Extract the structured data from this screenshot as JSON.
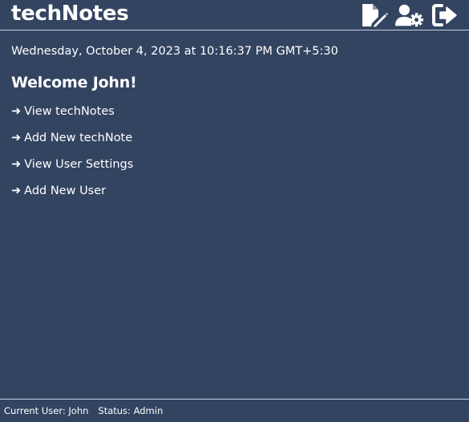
{
  "header": {
    "title": "techNotes",
    "actions": [
      {
        "name": "new-note-button",
        "icon": "file-pen-icon"
      },
      {
        "name": "user-settings-button",
        "icon": "user-gear-icon"
      },
      {
        "name": "logout-button",
        "icon": "sign-out-icon"
      }
    ]
  },
  "main": {
    "date": "Wednesday, October 4, 2023 at 10:16:37 PM GMT+5:30",
    "welcome": "Welcome John!",
    "links": [
      {
        "arrow": "➜",
        "label": "View techNotes"
      },
      {
        "arrow": "➜",
        "label": "Add New techNote"
      },
      {
        "arrow": "➜",
        "label": "View User Settings"
      },
      {
        "arrow": "➜",
        "label": "Add New User"
      }
    ]
  },
  "footer": {
    "current_user": "Current User: John",
    "status": "Status: Admin"
  },
  "colors": {
    "background": "#334461",
    "text": "#ffffff",
    "divider": "#c9d2df"
  }
}
